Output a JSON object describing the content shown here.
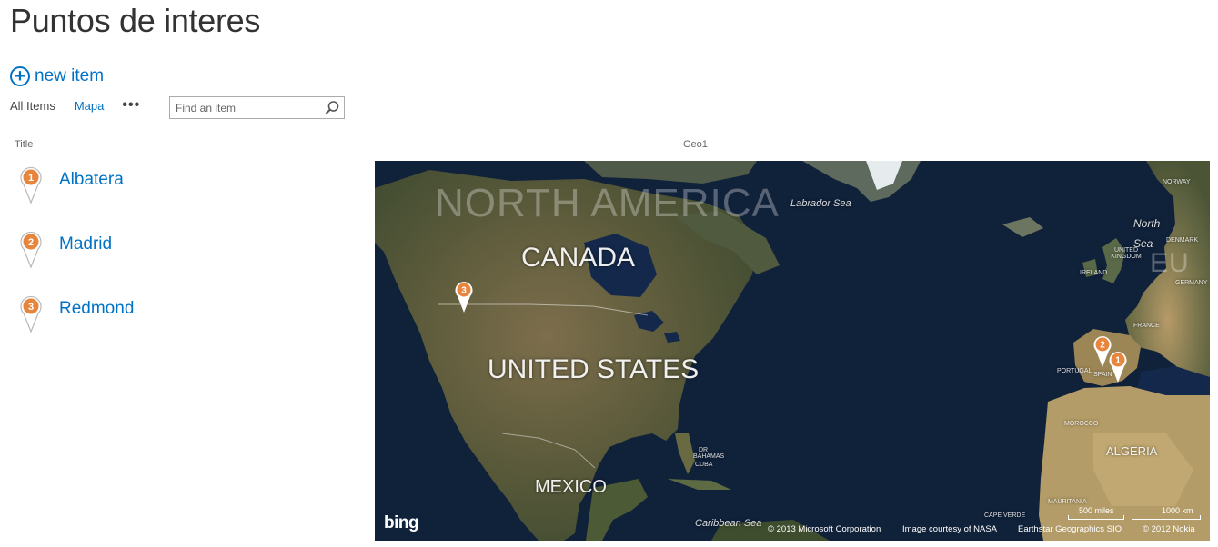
{
  "page": {
    "title": "Puntos de interes"
  },
  "toolbar": {
    "new_item_label": "new item",
    "plus_glyph": "+"
  },
  "views": {
    "all_items": "All Items",
    "map": "Mapa",
    "more": "•••"
  },
  "search": {
    "placeholder": "Find an item",
    "value": ""
  },
  "columns": {
    "title": "Title",
    "geo": "Geo1"
  },
  "items": [
    {
      "number": "1",
      "title": "Albatera"
    },
    {
      "number": "2",
      "title": "Madrid"
    },
    {
      "number": "3",
      "title": "Redmond"
    }
  ],
  "map": {
    "labels": {
      "north_america": "NORTH AMERICA",
      "canada": "CANADA",
      "united_states": "UNITED STATES",
      "mexico": "MEXICO",
      "algeria": "ALGERIA",
      "labrador_sea": "Labrador Sea",
      "north_sea": "North Sea",
      "caribbean_sea": "Caribbean Sea",
      "norway": "NORWAY",
      "denmark": "DENMARK",
      "united_kingdom": "UNITED KINGDOM",
      "ireland": "IRELAND",
      "germany": "GERMANY",
      "france": "FRANCE",
      "portugal": "PORTUGAL",
      "spain": "SPAIN",
      "morocco": "MOROCCO",
      "mauritania": "MAURITANIA",
      "cape_verde": "CAPE VERDE",
      "bahamas": "BAHAMAS",
      "cuba": "CUBA",
      "dr": "DR",
      "eu_partial": "EU"
    },
    "markers": [
      "1",
      "2",
      "3"
    ],
    "logo": "bing",
    "scale_miles": "500 miles",
    "scale_km": "1000 km",
    "attribution": {
      "microsoft": "© 2013 Microsoft Corporation",
      "nasa": "Image courtesy of NASA",
      "earthstar": "Earthstar Geographics SIO",
      "nokia": "© 2012 Nokia"
    },
    "marker_color": "#e8853d"
  },
  "colors": {
    "accent": "#0072c6",
    "pin": "#e8853d"
  }
}
